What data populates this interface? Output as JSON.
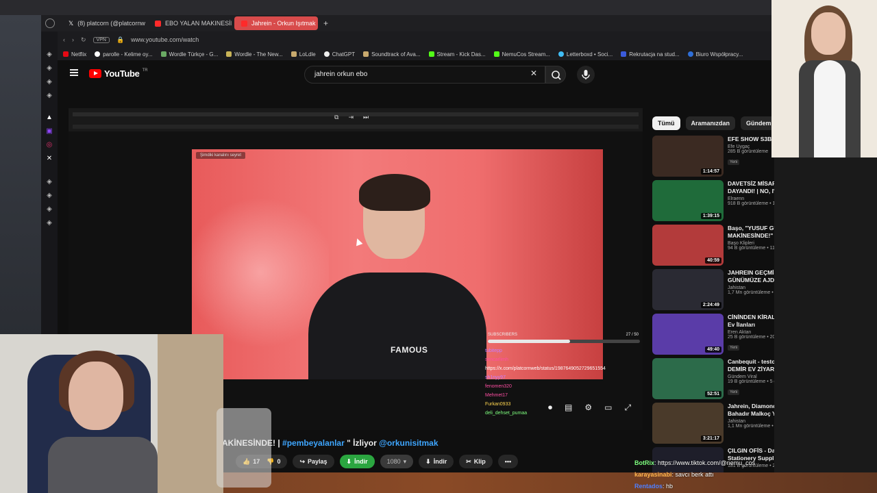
{
  "tabs": [
    {
      "label": "(8) platcorn (@platcornw",
      "icon": "x-icon"
    },
    {
      "label": "EBO YALAN MAKINESİNDE",
      "icon": "youtube-icon"
    },
    {
      "label": "Jahrein - Orkun Işıtmak",
      "icon": "youtube-icon",
      "active": true
    }
  ],
  "address": {
    "vpn": "VPN",
    "url": "www.youtube.com/watch"
  },
  "bookmarks": [
    "Netflix",
    "parolle - Kelime oy...",
    "Wordle Türkçe - G...",
    "Wordle - The New...",
    "LoLdle",
    "ChatGPT",
    "Soundtrack of Ava...",
    "Stream - Kick Das...",
    "NemuCos Stream...",
    "Letterboxd • Soci...",
    "Rekrutacja na stud...",
    "Biuro Współpracy..."
  ],
  "youtube": {
    "logo": "YouTube",
    "region": "TR",
    "search_value": "jahrein orkun ebo"
  },
  "video": {
    "tag": "Şimdiki kanalını seyret",
    "shirt_text": "FAMOUS",
    "subs_label": "SUBSCRIBERS",
    "subs_count": "27 / 50",
    "subs_progress": 0.54,
    "chat": [
      {
        "user": "tubitepp",
        "cls": "u1"
      },
      {
        "user": "sencarlimh",
        "cls": "u2"
      },
      {
        "text": "https://x.com/platcornweb/status/1987649052729651554",
        "cls": "link"
      },
      {
        "user": "sh1nyy97",
        "cls": "u1"
      },
      {
        "user": "fenomen320",
        "cls": "u2"
      },
      {
        "user": "Mehmet17",
        "cls": "u2"
      },
      {
        "user": "Furkan0933",
        "cls": "u3"
      },
      {
        "user": "deli_dehset_pumaa",
        "cls": "u5"
      }
    ],
    "title_prefix": "MAKİNESİNDE! | ",
    "title_tag1": "#pembeyalanlar",
    "title_mid": " \" İzliyor ",
    "title_tag2": "@orkunisitmak",
    "actions": {
      "like": "17",
      "dislike": "0",
      "share": "Paylaş",
      "download_green": "İndir",
      "quality": "1080",
      "download": "İndir",
      "clip": "Klip"
    }
  },
  "chips": [
    "Tümü",
    "Aramanızdan",
    "Gündem Vira"
  ],
  "recs": [
    {
      "title": "EFE SHOW S3BÖ",
      "channel": "Efe Uygaç",
      "stats": "285 B görüntüleme",
      "badge": "Yeni",
      "duration": "1:14:57",
      "color": "#3b2a22"
    },
    {
      "title": "DAVETSİZ MİSAFİRLER KAPIYA DAYANDI! | NO, I'M NOT A ...",
      "channel": "Elraenn",
      "stats": "918 B görüntüleme • 13 gün önce",
      "badge": "",
      "duration": "1:39:15",
      "color": "#1f6b3a"
    },
    {
      "title": "Başo, \"YUSUF GÜNEY YALAN MAKİNESİNDE!\" İZLİYOR! ...",
      "channel": "Başo Klipleri",
      "stats": "94 B görüntüleme • 11 ay önce",
      "badge": "",
      "duration": "40:59",
      "color": "#b33b3b"
    },
    {
      "title": "JAHREIN GEÇMİŞTEN GÜNÜMÜZE AJDAR LORE ...",
      "channel": "Jahistan",
      "stats": "1,7 Mn görüntüleme • 1 yıl önce",
      "badge": "",
      "duration": "2:24:49",
      "color": "#2a2a33"
    },
    {
      "title": "CİNİNDEN KİRALIK 🏠 Korkunç Ev İlanları",
      "channel": "Eren Aktan",
      "stats": "25 B görüntüleme • 20 saat önce",
      "badge": "Yeni",
      "duration": "49:40",
      "color": "#5a3ca8"
    },
    {
      "title": "Canbequit - testo taylan \" GÜVEN DEMİR EV ZİYARETİ \" ...",
      "channel": "Gündem Viral",
      "stats": "19 B görüntüleme • 5 gün önce",
      "badge": "Yeni",
      "duration": "52:51",
      "color": "#2c6b4a"
    },
    {
      "title": "Jahrein, Diamond Tema VS Bahadır Malkoç Yaratıcı Var m...",
      "channel": "Jahistan",
      "stats": "1,1 Mn görüntüleme • 1 yıl önce",
      "badge": "",
      "duration": "3:21:17",
      "color": "#4a3a2a"
    },
    {
      "title": "ÇILGIN OFİS - Dale & Dawson Stationery Supplies",
      "channel": "",
      "stats": "181 B görüntüleme • 2 yıl önce",
      "badge": "",
      "duration": "",
      "color": "#1e1e2a"
    }
  ],
  "chat_bottom": [
    {
      "user": "BotRix",
      "cls": "bot",
      "msg": ": https://www.tiktok.com/@nemu_cos"
    },
    {
      "user": "karayasinabi",
      "cls": "k",
      "msg": ": savcı berk attı"
    },
    {
      "user": "Rentados",
      "cls": "r",
      "msg": ": hb"
    }
  ]
}
